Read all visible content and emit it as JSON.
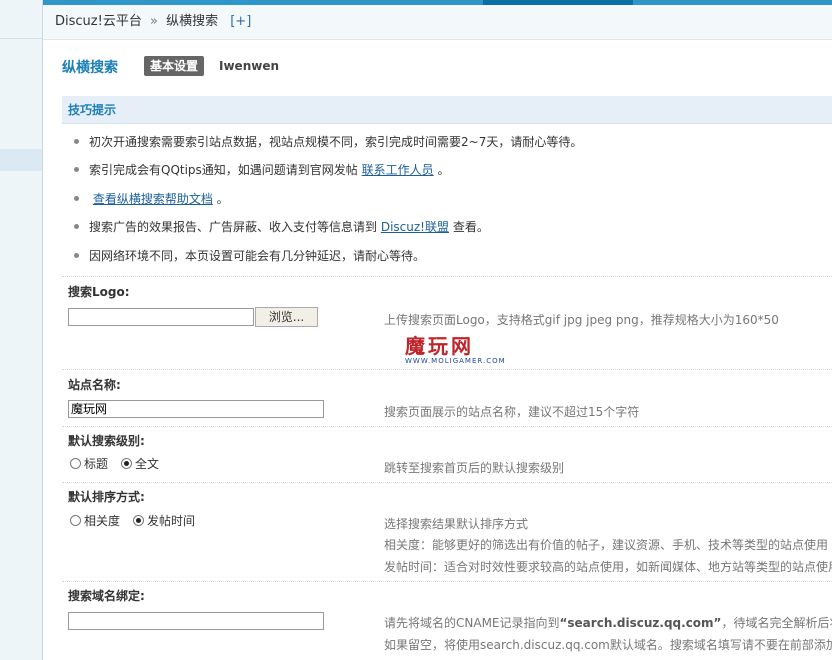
{
  "breadcrumb": {
    "root": "Discuz!云平台",
    "separator": "»",
    "current": "纵横搜索",
    "add_label": "[+]"
  },
  "header": {
    "title": "纵横搜索",
    "active_tab": "基本设置",
    "other_tab": "Iwenwen"
  },
  "tips": {
    "title": "技巧提示",
    "items": [
      {
        "text": "初次开通搜索需要索引站点数据，视站点规模不同，索引完成时间需要2~7天，请耐心等待。"
      },
      {
        "pre": "索引完成会有QQtips通知，如遇问题请到官网发帖",
        "link": "联系工作人员",
        "post": "。"
      },
      {
        "pre": "",
        "link": "查看纵横搜索帮助文档",
        "post": "。"
      },
      {
        "pre": "搜索广告的效果报告、广告屏蔽、收入支付等信息请到",
        "link": "Discuz!联盟",
        "post": "查看。"
      },
      {
        "text": "因网络环境不同，本页设置可能会有几分钟延迟，请耐心等待。"
      }
    ]
  },
  "form": {
    "logo": {
      "label": "搜索Logo:",
      "value": "",
      "browse_label": "浏览...",
      "hint": "上传搜索页面Logo，支持格式gif jpg jpeg png，推荐规格大小为160*50"
    },
    "watermark": {
      "text": "魔玩网",
      "sub": "WWW.MOLIGAMER.COM"
    },
    "site_name": {
      "label": "站点名称:",
      "value": "魔玩网",
      "hint": "搜索页面展示的站点名称，建议不超过15个字符"
    },
    "search_level": {
      "label": "默认搜索级别:",
      "options": [
        "标题",
        "全文"
      ],
      "selected": "全文",
      "hint": "跳转至搜索首页后的默认搜索级别"
    },
    "sort_order": {
      "label": "默认排序方式:",
      "options": [
        "相关度",
        "发帖时间"
      ],
      "selected": "发帖时间",
      "hint1": "选择搜索结果默认排序方式",
      "hint2": "相关度：能够更好的筛选出有价值的帖子，建议资源、手机、技术等类型的站点使用",
      "hint3": "发帖时间：适合对时效性要求较高的站点使用，如新闻媒体、地方站等类型的站点使用"
    },
    "domain": {
      "label": "搜索域名绑定:",
      "value": "",
      "hint1_pre": "请先将域名的CNAME记录指向到",
      "hint1_bold": "“search.discuz.qq.com”",
      "hint1_post": "，待域名完全解析后将",
      "hint2": "如果留空，将使用search.discuz.qq.com默认域名。搜索域名填写请不要在前部添加"
    }
  }
}
